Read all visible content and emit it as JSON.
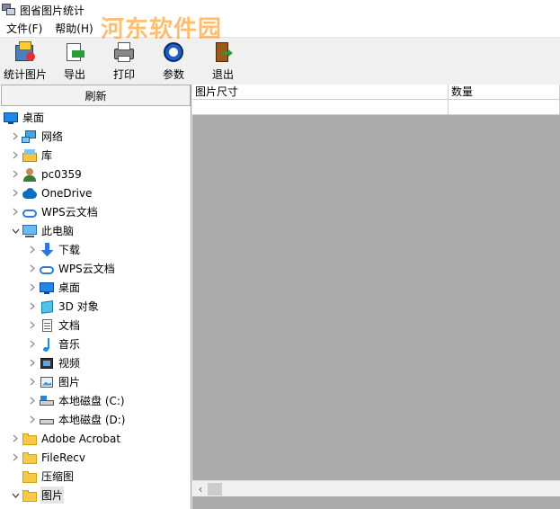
{
  "window": {
    "title": "图省图片统计"
  },
  "menu": {
    "items": [
      "文件(F)",
      "帮助(H)"
    ]
  },
  "watermark": {
    "text": "河东软件园",
    "url": "www.pc0359.cn"
  },
  "toolbar": {
    "buttons": [
      {
        "label": "统计图片",
        "icon": "stats-icon"
      },
      {
        "label": "导出",
        "icon": "export-icon"
      },
      {
        "label": "打印",
        "icon": "print-icon"
      },
      {
        "label": "参数",
        "icon": "settings-icon"
      },
      {
        "label": "退出",
        "icon": "exit-icon"
      }
    ]
  },
  "sidebar": {
    "refresh_label": "刷新",
    "tree": [
      {
        "label": "桌面",
        "icon": "desktop-icon",
        "level": 0,
        "expander": "none"
      },
      {
        "label": "网络",
        "icon": "network-icon",
        "level": 1,
        "expander": "collapsed"
      },
      {
        "label": "库",
        "icon": "library-icon",
        "level": 1,
        "expander": "collapsed"
      },
      {
        "label": "pc0359",
        "icon": "user-icon",
        "level": 1,
        "expander": "collapsed"
      },
      {
        "label": "OneDrive",
        "icon": "cloud-icon",
        "level": 1,
        "expander": "collapsed"
      },
      {
        "label": "WPS云文档",
        "icon": "wps-cloud-icon",
        "level": 1,
        "expander": "collapsed"
      },
      {
        "label": "此电脑",
        "icon": "computer-icon",
        "level": 1,
        "expander": "expanded"
      },
      {
        "label": "下载",
        "icon": "download-icon",
        "level": 2,
        "expander": "collapsed"
      },
      {
        "label": "WPS云文档",
        "icon": "wps-cloud-icon",
        "level": 2,
        "expander": "collapsed"
      },
      {
        "label": "桌面",
        "icon": "desktop-icon",
        "level": 2,
        "expander": "collapsed"
      },
      {
        "label": "3D 对象",
        "icon": "3d-objects-icon",
        "level": 2,
        "expander": "collapsed"
      },
      {
        "label": "文档",
        "icon": "document-icon",
        "level": 2,
        "expander": "collapsed"
      },
      {
        "label": "音乐",
        "icon": "music-icon",
        "level": 2,
        "expander": "collapsed"
      },
      {
        "label": "视频",
        "icon": "video-icon",
        "level": 2,
        "expander": "collapsed"
      },
      {
        "label": "图片",
        "icon": "picture-icon",
        "level": 2,
        "expander": "collapsed"
      },
      {
        "label": "本地磁盘 (C:)",
        "icon": "drive-c-icon",
        "level": 2,
        "expander": "collapsed"
      },
      {
        "label": "本地磁盘 (D:)",
        "icon": "drive-d-icon",
        "level": 2,
        "expander": "collapsed"
      },
      {
        "label": "Adobe Acrobat",
        "icon": "folder-icon",
        "level": 1,
        "expander": "collapsed"
      },
      {
        "label": "FileRecv",
        "icon": "folder-icon",
        "level": 1,
        "expander": "collapsed"
      },
      {
        "label": "压缩图",
        "icon": "folder-icon",
        "level": 1,
        "expander": "none"
      },
      {
        "label": "图片",
        "icon": "folder-icon",
        "level": 1,
        "expander": "expanded",
        "selected": true
      }
    ]
  },
  "grid": {
    "columns": [
      "图片尺寸",
      "数量"
    ],
    "rows": [
      [
        "",
        ""
      ]
    ]
  },
  "colors": {
    "window_bg": "#f0f0f0",
    "grid_empty_bg": "#ababab",
    "selection_bg": "#e5e5e5",
    "watermark_orange": "#ff8a00",
    "watermark_blue": "#2e6fbf"
  }
}
